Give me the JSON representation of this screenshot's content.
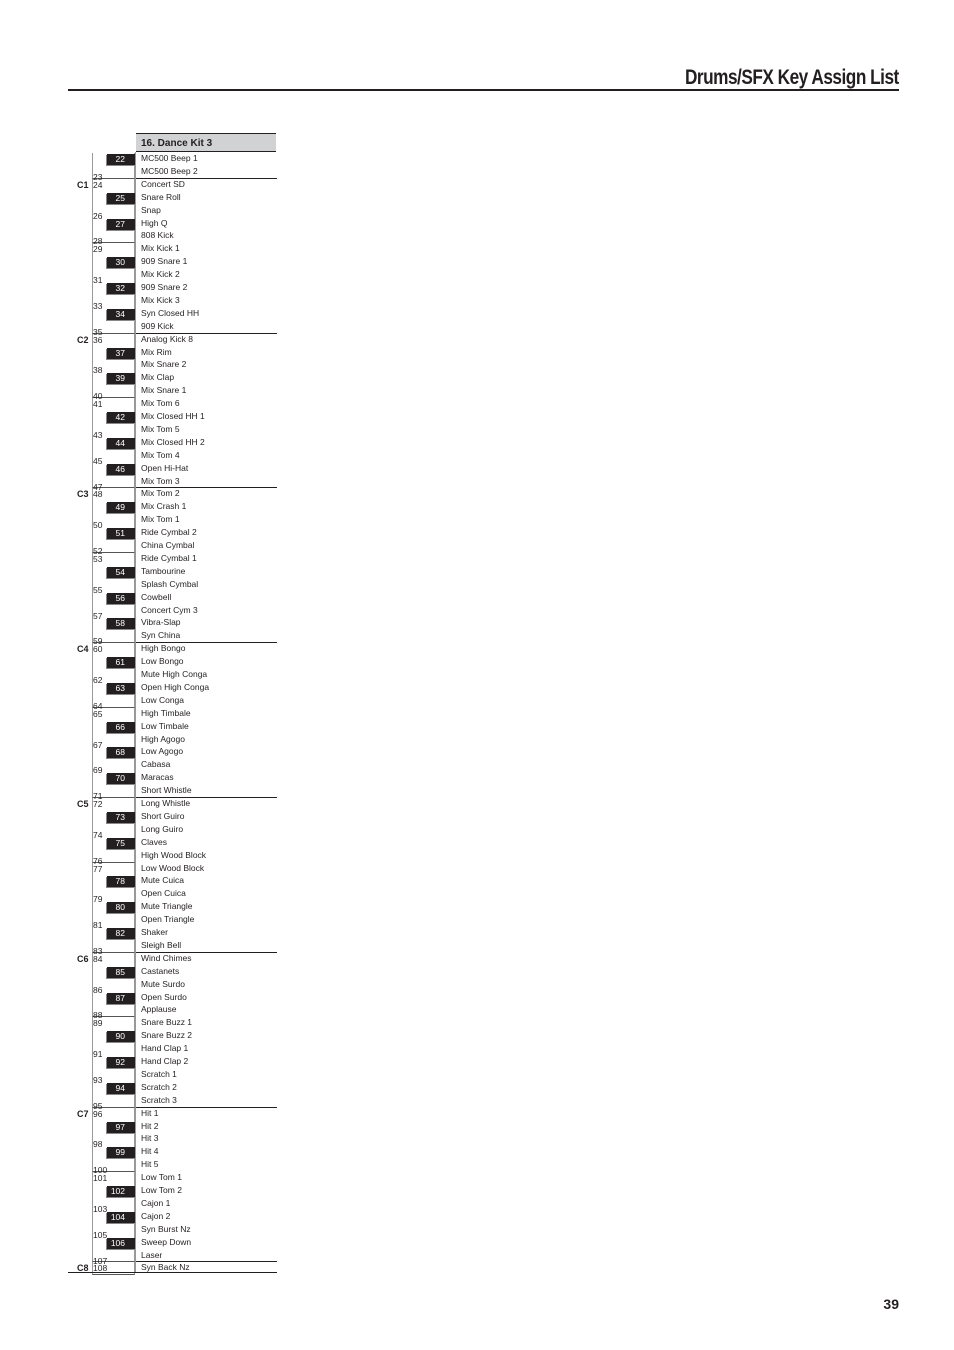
{
  "header": {
    "title": "Drums/SFX Key Assign List"
  },
  "page_number": "39",
  "kit": {
    "title": "16. Dance Kit 3"
  },
  "keys": [
    {
      "note": 22,
      "name": "MC500 Beep 1"
    },
    {
      "note": 23,
      "name": "MC500 Beep 2"
    },
    {
      "note": 24,
      "name": "Concert SD",
      "octave": "C1"
    },
    {
      "note": 25,
      "name": "Snare Roll"
    },
    {
      "note": 26,
      "name": "Snap"
    },
    {
      "note": 27,
      "name": "High Q"
    },
    {
      "note": 28,
      "name": "808 Kick"
    },
    {
      "note": 29,
      "name": "Mix Kick 1"
    },
    {
      "note": 30,
      "name": "909 Snare 1"
    },
    {
      "note": 31,
      "name": "Mix Kick 2"
    },
    {
      "note": 32,
      "name": "909 Snare 2"
    },
    {
      "note": 33,
      "name": "Mix Kick 3"
    },
    {
      "note": 34,
      "name": "Syn Closed HH"
    },
    {
      "note": 35,
      "name": "909 Kick"
    },
    {
      "note": 36,
      "name": "Analog Kick 8",
      "octave": "C2"
    },
    {
      "note": 37,
      "name": "Mix Rim"
    },
    {
      "note": 38,
      "name": "Mix Snare 2"
    },
    {
      "note": 39,
      "name": "Mix Clap"
    },
    {
      "note": 40,
      "name": "Mix Snare 1"
    },
    {
      "note": 41,
      "name": "Mix Tom 6"
    },
    {
      "note": 42,
      "name": "Mix Closed HH 1"
    },
    {
      "note": 43,
      "name": "Mix Tom 5"
    },
    {
      "note": 44,
      "name": "Mix Closed HH 2"
    },
    {
      "note": 45,
      "name": "Mix Tom 4"
    },
    {
      "note": 46,
      "name": "Open Hi-Hat"
    },
    {
      "note": 47,
      "name": "Mix Tom 3"
    },
    {
      "note": 48,
      "name": "Mix Tom 2",
      "octave": "C3"
    },
    {
      "note": 49,
      "name": "Mix Crash 1"
    },
    {
      "note": 50,
      "name": "Mix Tom 1"
    },
    {
      "note": 51,
      "name": "Ride Cymbal 2"
    },
    {
      "note": 52,
      "name": "China Cymbal"
    },
    {
      "note": 53,
      "name": "Ride Cymbal 1"
    },
    {
      "note": 54,
      "name": "Tambourine"
    },
    {
      "note": 55,
      "name": "Splash Cymbal"
    },
    {
      "note": 56,
      "name": "Cowbell"
    },
    {
      "note": 57,
      "name": "Concert Cym 3"
    },
    {
      "note": 58,
      "name": "Vibra-Slap"
    },
    {
      "note": 59,
      "name": "Syn China"
    },
    {
      "note": 60,
      "name": "High Bongo",
      "octave": "C4"
    },
    {
      "note": 61,
      "name": "Low Bongo"
    },
    {
      "note": 62,
      "name": "Mute High Conga"
    },
    {
      "note": 63,
      "name": "Open High Conga"
    },
    {
      "note": 64,
      "name": "Low Conga"
    },
    {
      "note": 65,
      "name": "High Timbale"
    },
    {
      "note": 66,
      "name": "Low Timbale"
    },
    {
      "note": 67,
      "name": "High Agogo"
    },
    {
      "note": 68,
      "name": "Low Agogo"
    },
    {
      "note": 69,
      "name": "Cabasa"
    },
    {
      "note": 70,
      "name": "Maracas"
    },
    {
      "note": 71,
      "name": "Short Whistle"
    },
    {
      "note": 72,
      "name": "Long  Whistle",
      "octave": "C5"
    },
    {
      "note": 73,
      "name": "Short Guiro"
    },
    {
      "note": 74,
      "name": "Long Guiro"
    },
    {
      "note": 75,
      "name": "Claves"
    },
    {
      "note": 76,
      "name": "High  Wood Block"
    },
    {
      "note": 77,
      "name": "Low Wood Block"
    },
    {
      "note": 78,
      "name": "Mute Cuica"
    },
    {
      "note": 79,
      "name": "Open Cuica"
    },
    {
      "note": 80,
      "name": "Mute Triangle"
    },
    {
      "note": 81,
      "name": "Open Triangle"
    },
    {
      "note": 82,
      "name": "Shaker"
    },
    {
      "note": 83,
      "name": "Sleigh Bell"
    },
    {
      "note": 84,
      "name": "Wind Chimes",
      "octave": "C6"
    },
    {
      "note": 85,
      "name": "Castanets"
    },
    {
      "note": 86,
      "name": "Mute Surdo"
    },
    {
      "note": 87,
      "name": "Open Surdo"
    },
    {
      "note": 88,
      "name": "Applause"
    },
    {
      "note": 89,
      "name": "Snare Buzz 1"
    },
    {
      "note": 90,
      "name": "Snare Buzz 2"
    },
    {
      "note": 91,
      "name": "Hand Clap 1"
    },
    {
      "note": 92,
      "name": "Hand Clap 2"
    },
    {
      "note": 93,
      "name": "Scratch 1"
    },
    {
      "note": 94,
      "name": "Scratch 2"
    },
    {
      "note": 95,
      "name": "Scratch 3"
    },
    {
      "note": 96,
      "name": "Hit 1",
      "octave": "C7"
    },
    {
      "note": 97,
      "name": "Hit 2"
    },
    {
      "note": 98,
      "name": "Hit 3"
    },
    {
      "note": 99,
      "name": "Hit 4"
    },
    {
      "note": 100,
      "name": "Hit 5"
    },
    {
      "note": 101,
      "name": "Low Tom 1"
    },
    {
      "note": 102,
      "name": "Low Tom 2"
    },
    {
      "note": 103,
      "name": "Cajon 1"
    },
    {
      "note": 104,
      "name": "Cajon 2"
    },
    {
      "note": 105,
      "name": "Syn Burst Nz"
    },
    {
      "note": 106,
      "name": "Sweep Down"
    },
    {
      "note": 107,
      "name": "Laser"
    },
    {
      "note": 108,
      "name": "Syn Back Nz",
      "octave": "C8"
    }
  ]
}
